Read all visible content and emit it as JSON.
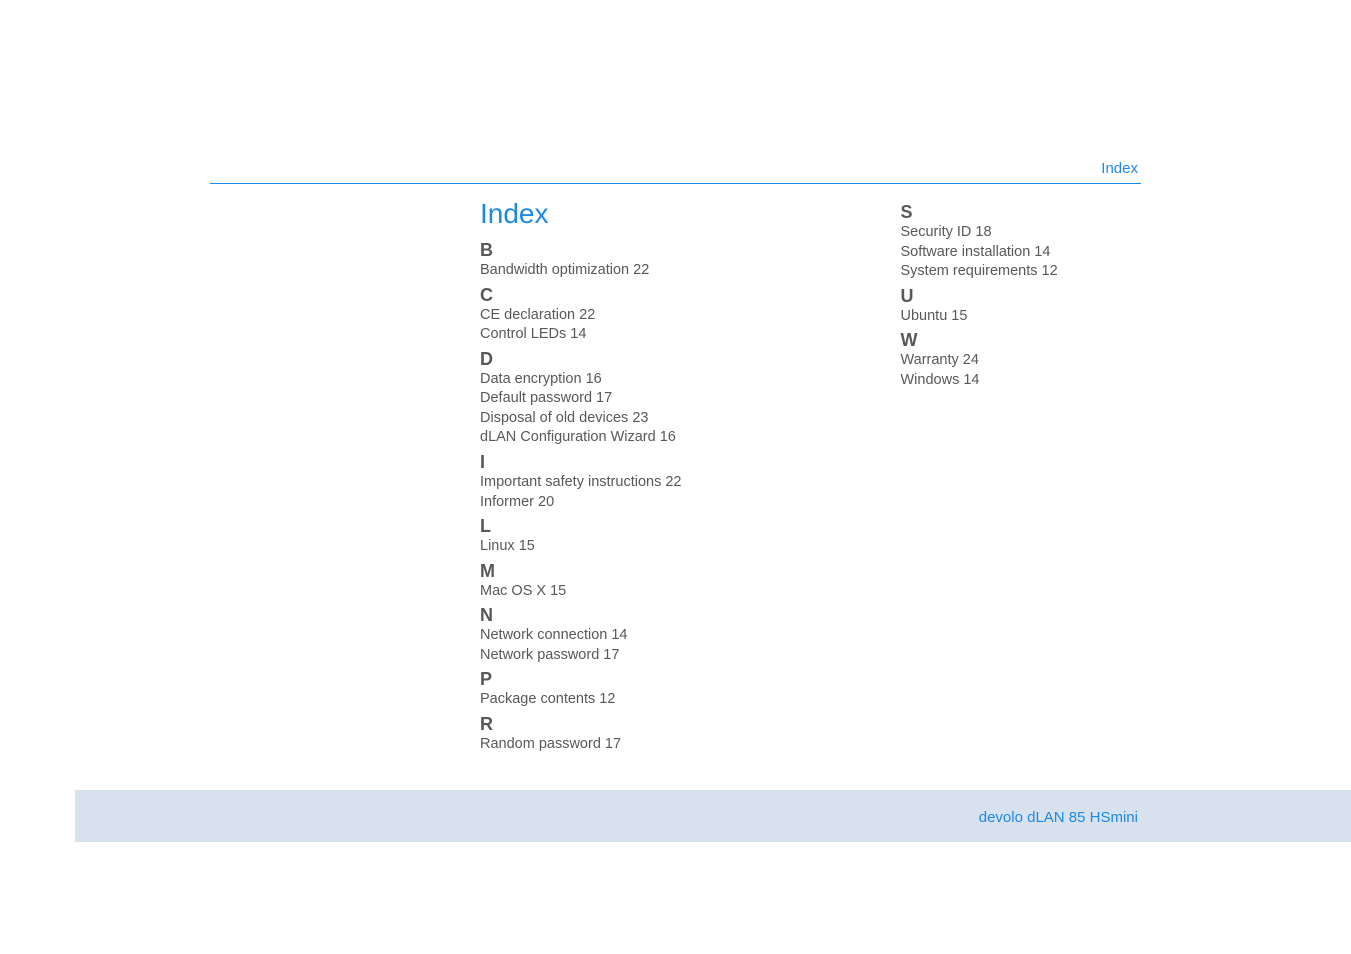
{
  "breadcrumb": "Index",
  "title": "Index",
  "footer": "devolo dLAN 85 HSmini",
  "col1": [
    {
      "type": "letter",
      "text": "B"
    },
    {
      "type": "entry",
      "text": "Bandwidth optimization 22"
    },
    {
      "type": "letter",
      "text": "C"
    },
    {
      "type": "entry",
      "text": "CE declaration 22"
    },
    {
      "type": "entry",
      "text": "Control LEDs 14"
    },
    {
      "type": "letter",
      "text": "D"
    },
    {
      "type": "entry",
      "text": "Data encryption 16"
    },
    {
      "type": "entry",
      "text": "Default password 17"
    },
    {
      "type": "entry",
      "text": "Disposal of old devices 23"
    },
    {
      "type": "entry",
      "text": "dLAN Configuration Wizard 16"
    },
    {
      "type": "letter",
      "text": "I"
    },
    {
      "type": "entry",
      "text": "Important safety instructions 22"
    },
    {
      "type": "entry",
      "text": "Informer 20"
    },
    {
      "type": "letter",
      "text": "L"
    },
    {
      "type": "entry",
      "text": "Linux 15"
    },
    {
      "type": "letter",
      "text": "M"
    },
    {
      "type": "entry",
      "text": "Mac OS X 15"
    },
    {
      "type": "letter",
      "text": "N"
    },
    {
      "type": "entry",
      "text": "Network connection 14"
    },
    {
      "type": "entry",
      "text": "Network password 17"
    },
    {
      "type": "letter",
      "text": "P"
    },
    {
      "type": "entry",
      "text": "Package contents 12"
    },
    {
      "type": "letter",
      "text": "R"
    },
    {
      "type": "entry",
      "text": "Random password 17"
    }
  ],
  "col2": [
    {
      "type": "letter",
      "text": "S"
    },
    {
      "type": "entry",
      "text": "Security ID 18"
    },
    {
      "type": "entry",
      "text": "Software installation 14"
    },
    {
      "type": "entry",
      "text": "System requirements 12"
    },
    {
      "type": "letter",
      "text": "U"
    },
    {
      "type": "entry",
      "text": "Ubuntu 15"
    },
    {
      "type": "letter",
      "text": "W"
    },
    {
      "type": "entry",
      "text": "Warranty 24"
    },
    {
      "type": "entry",
      "text": "Windows 14"
    }
  ]
}
